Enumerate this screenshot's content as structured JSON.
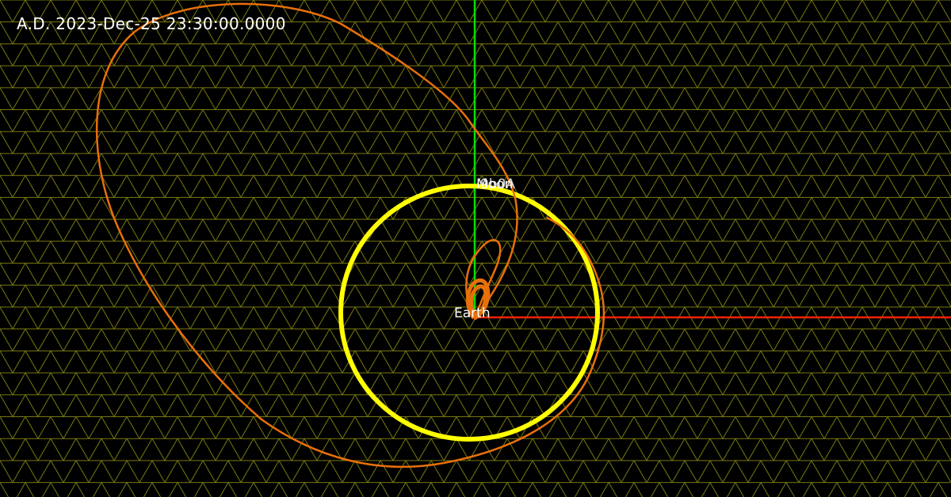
{
  "hud": {
    "epoch_text": "A.D. 2023-Dec-25 23:30:00.0000"
  },
  "labels": {
    "earth": "Earth",
    "moon": "Moon",
    "object": "9b0A"
  },
  "colors": {
    "background": "#000000",
    "grid": "#7a7a10",
    "x_axis": "#ff2000",
    "y_axis": "#00e000",
    "moon_orbit": "#ffff00",
    "object_trajectory": "#e8700a",
    "label_text": "#ffffff"
  },
  "scene": {
    "grid_type": "triangular",
    "axes": [
      "x-axis",
      "y-axis"
    ]
  }
}
